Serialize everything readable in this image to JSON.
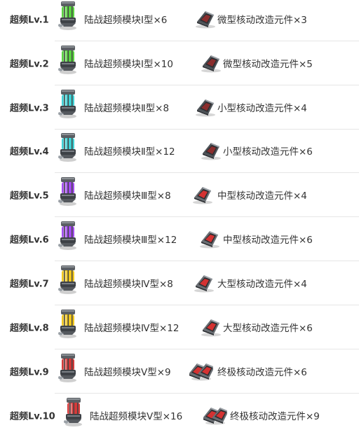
{
  "colors": {
    "t1": "#59d440",
    "t2": "#3fd2d6",
    "t3": "#a34cf0",
    "t4": "#f2c81e",
    "t5": "#d43a3a"
  },
  "rows": [
    {
      "level": "超频Lv.1",
      "module": "陆战超频模块Ⅰ型×6",
      "module_tier": "t1",
      "module_icon": "green-module-icon",
      "part": "微型核动改造元件×3",
      "part_icon": "micro-part-icon",
      "part_size": 1
    },
    {
      "level": "超频Lv.2",
      "module": "陆战超频模块Ⅰ型×10",
      "module_tier": "t1",
      "module_icon": "green-module-icon",
      "part": "微型核动改造元件×5",
      "part_icon": "micro-part-icon",
      "part_size": 1
    },
    {
      "level": "超频Lv.3",
      "module": "陆战超频模块Ⅱ型×8",
      "module_tier": "t2",
      "module_icon": "cyan-module-icon",
      "part": "小型核动改造元件×4",
      "part_icon": "small-part-icon",
      "part_size": 2
    },
    {
      "level": "超频Lv.4",
      "module": "陆战超频模块Ⅱ型×12",
      "module_tier": "t2",
      "module_icon": "cyan-module-icon",
      "part": "小型核动改造元件×6",
      "part_icon": "small-part-icon",
      "part_size": 2
    },
    {
      "level": "超频Lv.5",
      "module": "陆战超频模块Ⅲ型×8",
      "module_tier": "t3",
      "module_icon": "purple-module-icon",
      "part": "中型核动改造元件×4",
      "part_icon": "medium-part-icon",
      "part_size": 3
    },
    {
      "level": "超频Lv.6",
      "module": "陆战超频模块Ⅲ型×12",
      "module_tier": "t3",
      "module_icon": "purple-module-icon",
      "part": "中型核动改造元件×6",
      "part_icon": "medium-part-icon",
      "part_size": 3
    },
    {
      "level": "超频Lv.7",
      "module": "陆战超频模块Ⅳ型×8",
      "module_tier": "t4",
      "module_icon": "gold-module-icon",
      "part": "大型核动改造元件×4",
      "part_icon": "large-part-icon",
      "part_size": 4
    },
    {
      "level": "超频Lv.8",
      "module": "陆战超频模块Ⅳ型×12",
      "module_tier": "t4",
      "module_icon": "gold-module-icon",
      "part": "大型核动改造元件×6",
      "part_icon": "large-part-icon",
      "part_size": 4
    },
    {
      "level": "超频Lv.9",
      "module": "陆战超频模块Ⅴ型×9",
      "module_tier": "t5",
      "module_icon": "red-module-icon",
      "part": "终极核动改造元件×6",
      "part_icon": "ultimate-part-icon",
      "part_size": 5
    },
    {
      "level": "超频Lv.10",
      "module": "陆战超频模块Ⅴ型×16",
      "module_tier": "t5",
      "module_icon": "red-module-icon",
      "part": "终极核动改造元件×9",
      "part_icon": "ultimate-part-icon",
      "part_size": 5
    }
  ]
}
